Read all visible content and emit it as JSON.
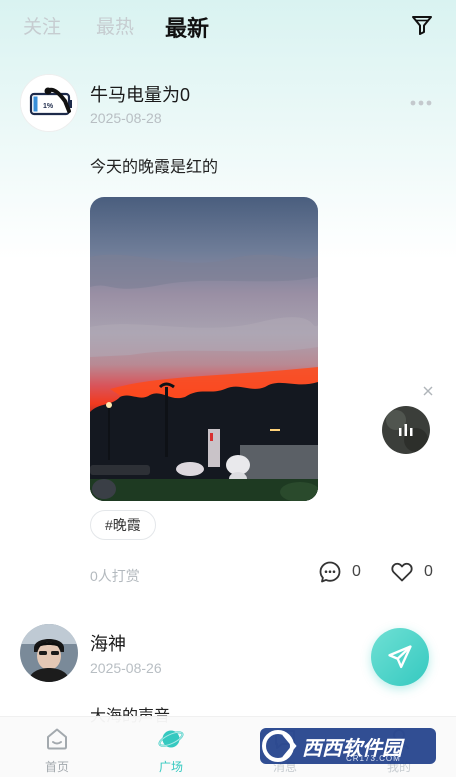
{
  "tabs": {
    "follow": "关注",
    "hot": "最热",
    "latest": "最新"
  },
  "posts": [
    {
      "username": "牛马电量为0",
      "date": "2025-08-28",
      "text": "今天的晚霞是红的",
      "tag": "#晚霞",
      "reward": "0人打赏",
      "comments": "0",
      "likes": "0",
      "avatar_battery_text": "1%"
    },
    {
      "username": "海神",
      "date": "2025-08-26",
      "text": "大海的声音"
    }
  ],
  "bottom_nav": {
    "home": "首页",
    "square": "广场",
    "messages": "消息",
    "mine": "我的"
  },
  "watermark": {
    "brand": "西西软件园",
    "domain": "CR173.COM"
  },
  "colors": {
    "accent": "#35c9c0",
    "tab_inactive": "#c6ccd0",
    "date": "#b8bec3"
  }
}
